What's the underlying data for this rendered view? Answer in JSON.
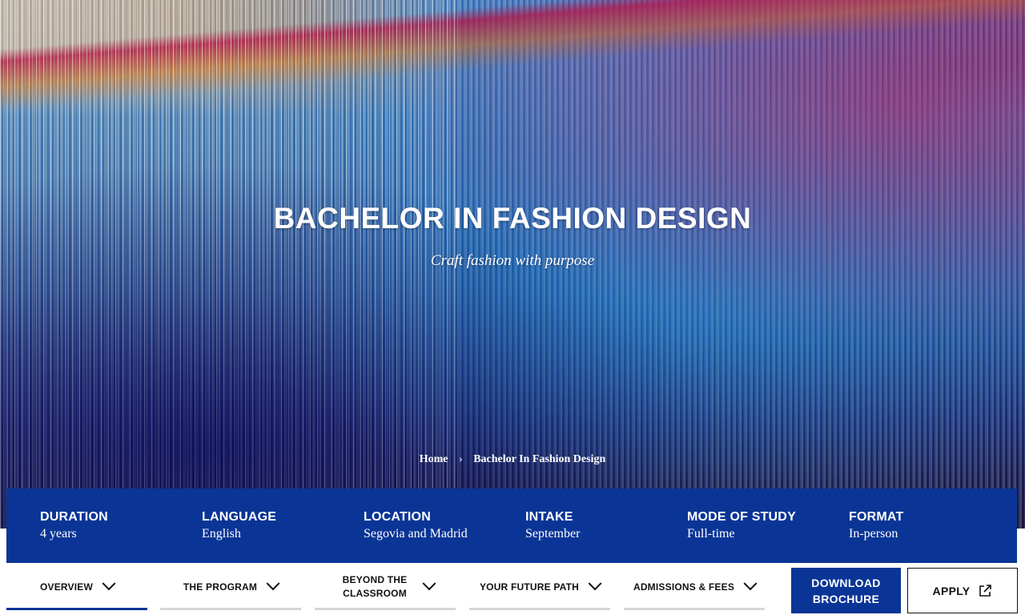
{
  "hero": {
    "title": "BACHELOR IN FASHION DESIGN",
    "subtitle": "Craft fashion with purpose",
    "image_icon": "woven-threads-photo"
  },
  "breadcrumb": {
    "home": "Home",
    "separator_icon": "chevron-right-icon",
    "current": "Bachelor In Fashion Design"
  },
  "info": [
    {
      "label": "DURATION",
      "value": "4 years"
    },
    {
      "label": "LANGUAGE",
      "value": "English"
    },
    {
      "label": "LOCATION",
      "value": "Segovia and Madrid"
    },
    {
      "label": "INTAKE",
      "value": "September"
    },
    {
      "label": "MODE OF STUDY",
      "value": "Full-time"
    },
    {
      "label": "FORMAT",
      "value": "In-person"
    }
  ],
  "tabs": [
    {
      "label": "OVERVIEW",
      "active": true
    },
    {
      "label": "THE PROGRAM",
      "active": false
    },
    {
      "label": "BEYOND THE CLASSROOM",
      "active": false
    },
    {
      "label": "YOUR FUTURE PATH",
      "active": false
    },
    {
      "label": "ADMISSIONS & FEES",
      "active": false
    }
  ],
  "actions": {
    "download_label": "DOWNLOAD BROCHURE",
    "apply_label": "APPLY",
    "apply_icon": "external-link-icon"
  },
  "colors": {
    "brand_blue": "#0a3596",
    "tab_inactive_underline": "#d6d6d6"
  }
}
